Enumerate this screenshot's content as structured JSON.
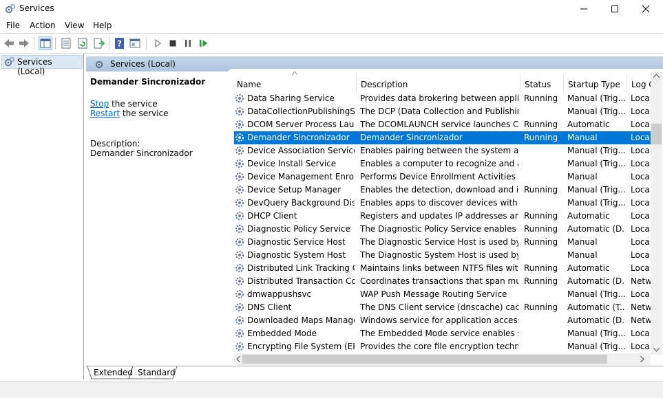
{
  "window": {
    "title": "Services",
    "icon": "gears-icon"
  },
  "menu": [
    "File",
    "Action",
    "View",
    "Help"
  ],
  "tree": {
    "item": "Services (Local)"
  },
  "header": {
    "title": "Services (Local)"
  },
  "description_panel": {
    "service_name": "Demander Sincronizador",
    "stop_link": "Stop",
    "stop_suffix": " the service",
    "restart_link": "Restart",
    "restart_suffix": " the service",
    "description_label": "Description:",
    "description_text": "Demander Sincronizador"
  },
  "columns": {
    "name": "Name",
    "description": "Description",
    "status": "Status",
    "startup": "Startup Type",
    "logon": "Log O"
  },
  "rows": [
    {
      "name": "Data Sharing Service",
      "description": "Provides data brokering between applica...",
      "status": "Running",
      "startup": "Manual (Trig...",
      "logon": "Loca"
    },
    {
      "name": "DataCollectionPublishingSe...",
      "description": "The DCP (Data Collection and Publishing...",
      "status": "",
      "startup": "Manual (Trig...",
      "logon": "Loca"
    },
    {
      "name": "DCOM Server Process Laun...",
      "description": "The DCOMLAUNCH service launches CO...",
      "status": "Running",
      "startup": "Automatic",
      "logon": "Loca"
    },
    {
      "name": "Demander Sincronizador",
      "description": "Demander Sincronizador",
      "status": "Running",
      "startup": "Manual",
      "logon": "Loca",
      "selected": true
    },
    {
      "name": "Device Association Service",
      "description": "Enables pairing between the system and ...",
      "status": "",
      "startup": "Manual (Trig...",
      "logon": "Loca"
    },
    {
      "name": "Device Install Service",
      "description": "Enables a computer to recognize and ada...",
      "status": "",
      "startup": "Manual (Trig...",
      "logon": "Loca"
    },
    {
      "name": "Device Management Enroll...",
      "description": "Performs Device Enrollment Activities for...",
      "status": "",
      "startup": "Manual",
      "logon": "Loca"
    },
    {
      "name": "Device Setup Manager",
      "description": "Enables the detection, download and inst...",
      "status": "Running",
      "startup": "Manual (Trig...",
      "logon": "Loca"
    },
    {
      "name": "DevQuery Background Disc...",
      "description": "Enables apps to discover devices with a b...",
      "status": "",
      "startup": "Manual (Trig...",
      "logon": "Loca"
    },
    {
      "name": "DHCP Client",
      "description": "Registers and updates IP addresses and D...",
      "status": "Running",
      "startup": "Automatic",
      "logon": "Loca"
    },
    {
      "name": "Diagnostic Policy Service",
      "description": "The Diagnostic Policy Service enables pr...",
      "status": "Running",
      "startup": "Automatic (D...",
      "logon": "Loca"
    },
    {
      "name": "Diagnostic Service Host",
      "description": "The Diagnostic Service Host is used by th...",
      "status": "Running",
      "startup": "Manual",
      "logon": "Loca"
    },
    {
      "name": "Diagnostic System Host",
      "description": "The Diagnostic System Host is used by th...",
      "status": "",
      "startup": "Manual",
      "logon": "Loca"
    },
    {
      "name": "Distributed Link Tracking Cl...",
      "description": "Maintains links between NTFS files withi...",
      "status": "Running",
      "startup": "Automatic",
      "logon": "Loca"
    },
    {
      "name": "Distributed Transaction Coo...",
      "description": "Coordinates transactions that span multi...",
      "status": "Running",
      "startup": "Automatic (D...",
      "logon": "Netw"
    },
    {
      "name": "dmwappushsvc",
      "description": "WAP Push Message Routing Service",
      "status": "",
      "startup": "Manual (Trig...",
      "logon": "Loca"
    },
    {
      "name": "DNS Client",
      "description": "The DNS Client service (dnscache) cache...",
      "status": "Running",
      "startup": "Automatic (T...",
      "logon": "Netw"
    },
    {
      "name": "Downloaded Maps Manager",
      "description": "Windows service for application access t...",
      "status": "",
      "startup": "Automatic (D...",
      "logon": "Netw"
    },
    {
      "name": "Embedded Mode",
      "description": "The Embedded Mode service enables sce...",
      "status": "",
      "startup": "Manual (Trig...",
      "logon": "Loca"
    },
    {
      "name": "Encrypting File System (EFS)",
      "description": "Provides the core file encryption technol...",
      "status": "",
      "startup": "Manual (Trig...",
      "logon": "Loca"
    }
  ],
  "tabs": [
    "Extended",
    "Standard"
  ],
  "colors": {
    "selection": "#0078d7",
    "header_band": "#b9cde4",
    "link": "#0066cc"
  }
}
